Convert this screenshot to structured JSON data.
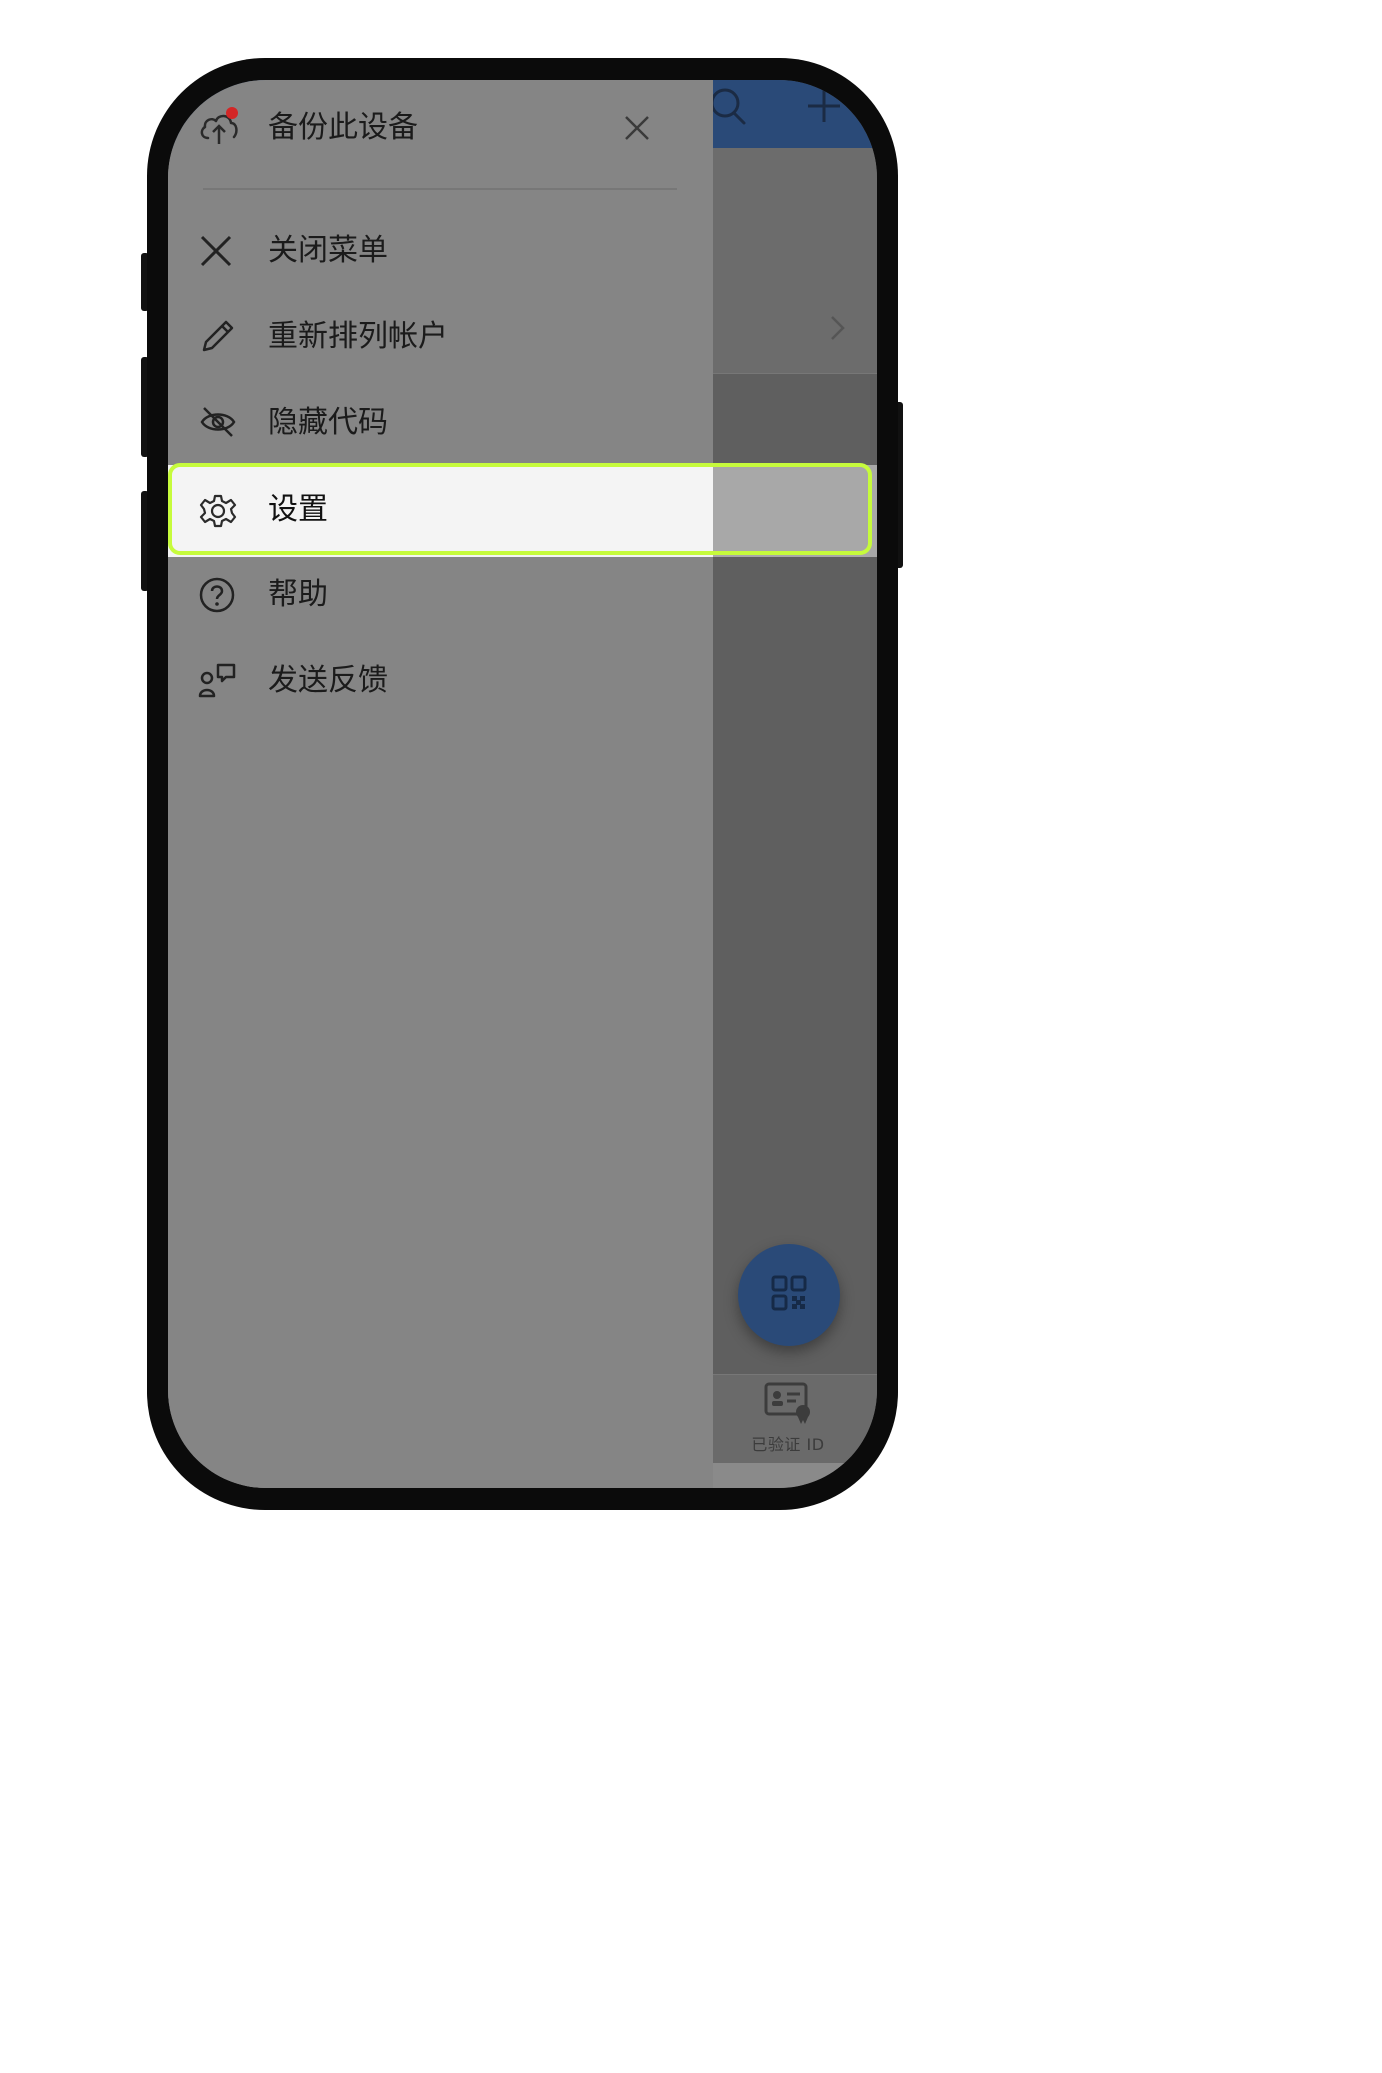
{
  "drawer": {
    "header_title": "备份此设备",
    "header_icon": "cloud-upload-icon",
    "close_icon": "close-icon",
    "items": [
      {
        "label": "关闭菜单",
        "icon": "close-icon"
      },
      {
        "label": "重新排列帐户",
        "icon": "pencil-icon"
      },
      {
        "label": "隐藏代码",
        "icon": "eye-off-icon"
      },
      {
        "label": "设置",
        "icon": "gear-icon",
        "highlighted": true
      },
      {
        "label": "帮助",
        "icon": "help-circle-icon"
      },
      {
        "label": "发送反馈",
        "icon": "feedback-icon"
      }
    ]
  },
  "app": {
    "header_icons": [
      "search-icon",
      "plus-icon"
    ],
    "bottom_tab": {
      "label": "已验证 ID",
      "icon": "verified-id-icon"
    },
    "fab_icon": "qr-scan-icon"
  },
  "colors": {
    "header_blue": "#2a4a78",
    "highlight_outline": "#c6fb3c",
    "notification_dot": "#d32626"
  }
}
